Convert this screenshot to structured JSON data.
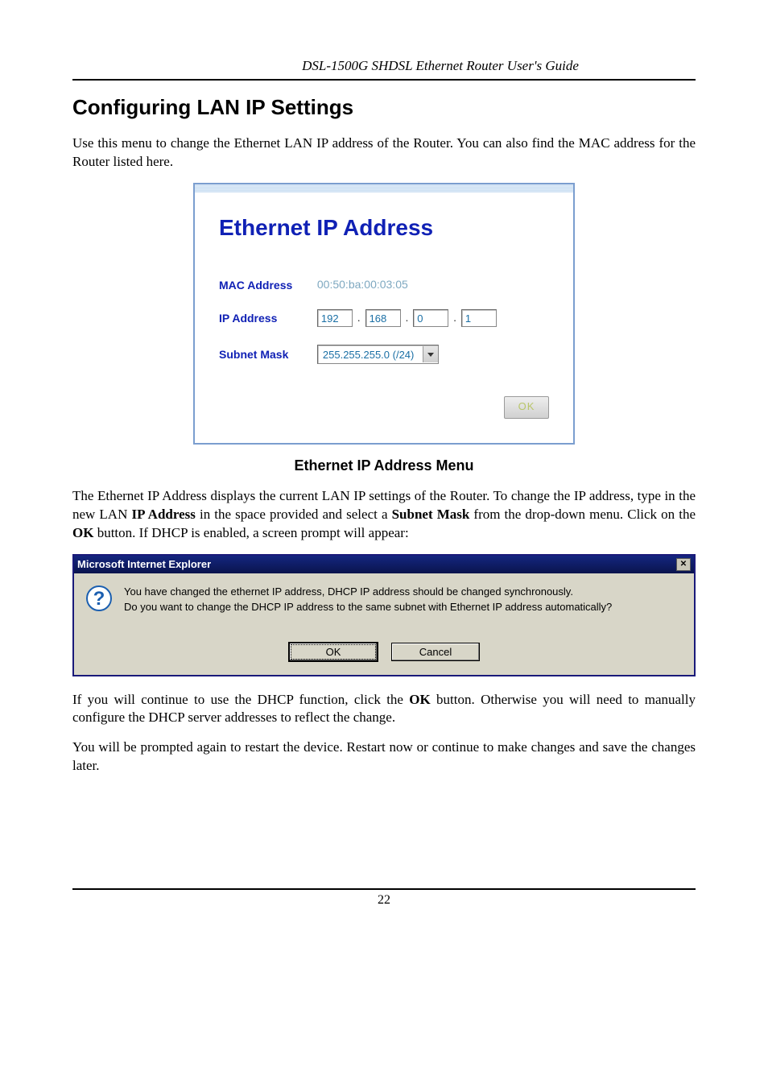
{
  "header": {
    "title": "DSL-1500G SHDSL Ethernet Router User's Guide"
  },
  "section": {
    "heading": "Configuring LAN IP Settings",
    "intro": "Use this menu to change the Ethernet LAN IP address of the Router. You can also find the MAC address for the Router listed here."
  },
  "panel": {
    "title": "Ethernet IP Address",
    "mac_label": "MAC Address",
    "mac_value": "00:50:ba:00:03:05",
    "ip_label": "IP Address",
    "ip": {
      "o1": "192",
      "o2": "168",
      "o3": "0",
      "o4": "1"
    },
    "dot": ".",
    "subnet_label": "Subnet Mask",
    "subnet_value": "255.255.255.0 (/24)",
    "ok": "OK"
  },
  "caption": "Ethernet IP Address Menu",
  "para2_parts": {
    "a": "The Ethernet IP Address displays the current LAN IP settings of the Router. To change the IP address, type in the new LAN ",
    "b": "IP Address",
    "c": " in the space provided and select a ",
    "d": "Subnet Mask",
    "e": " from the drop-down menu. Click on the ",
    "f": "OK",
    "g": " button. If DHCP is enabled, a screen prompt will appear:"
  },
  "dialog": {
    "title": "Microsoft Internet Explorer",
    "line1": "You have changed the ethernet IP address, DHCP IP address should be changed synchronously.",
    "line2": "Do you want to change the DHCP IP address to the same subnet with Ethernet IP address automatically?",
    "line3": " ",
    "ok": "OK",
    "cancel": "Cancel"
  },
  "para3_parts": {
    "a": "If you will continue to use the DHCP function, click the ",
    "b": "OK",
    "c": " button. Otherwise you will need to manually configure the DHCP server addresses to reflect the change."
  },
  "para4": "You will be prompted again to restart the device. Restart now or continue to make changes and save the changes later.",
  "page_number": "22"
}
